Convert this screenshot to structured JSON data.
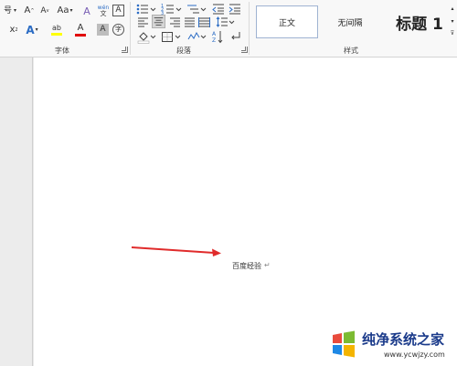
{
  "font_group": {
    "size_label": "号",
    "grow_font": "A",
    "shrink_font": "A",
    "change_case": "Aa",
    "clear_format": "A",
    "phonetic_guide": "wén",
    "char_border": "A",
    "superscript": "x",
    "text_effect": "A",
    "highlight": "ab",
    "font_color": "A",
    "char_shading": "A",
    "enclose_char": "字",
    "label": "字体"
  },
  "paragraph_group": {
    "label": "段落"
  },
  "styles_group": {
    "items": [
      "正文",
      "无间隔",
      "标题 1"
    ],
    "label": "样式"
  },
  "document": {
    "text": "百度经验",
    "para_mark": "↵"
  },
  "watermark": {
    "title": "纯净系统之家",
    "url": "www.ycwjzy.com"
  },
  "colors": {
    "arrow": "#e02b2b",
    "highlight_bar": "#ffff00",
    "font_color_bar": "#e00000",
    "accent_blue": "#2b6cc4"
  }
}
